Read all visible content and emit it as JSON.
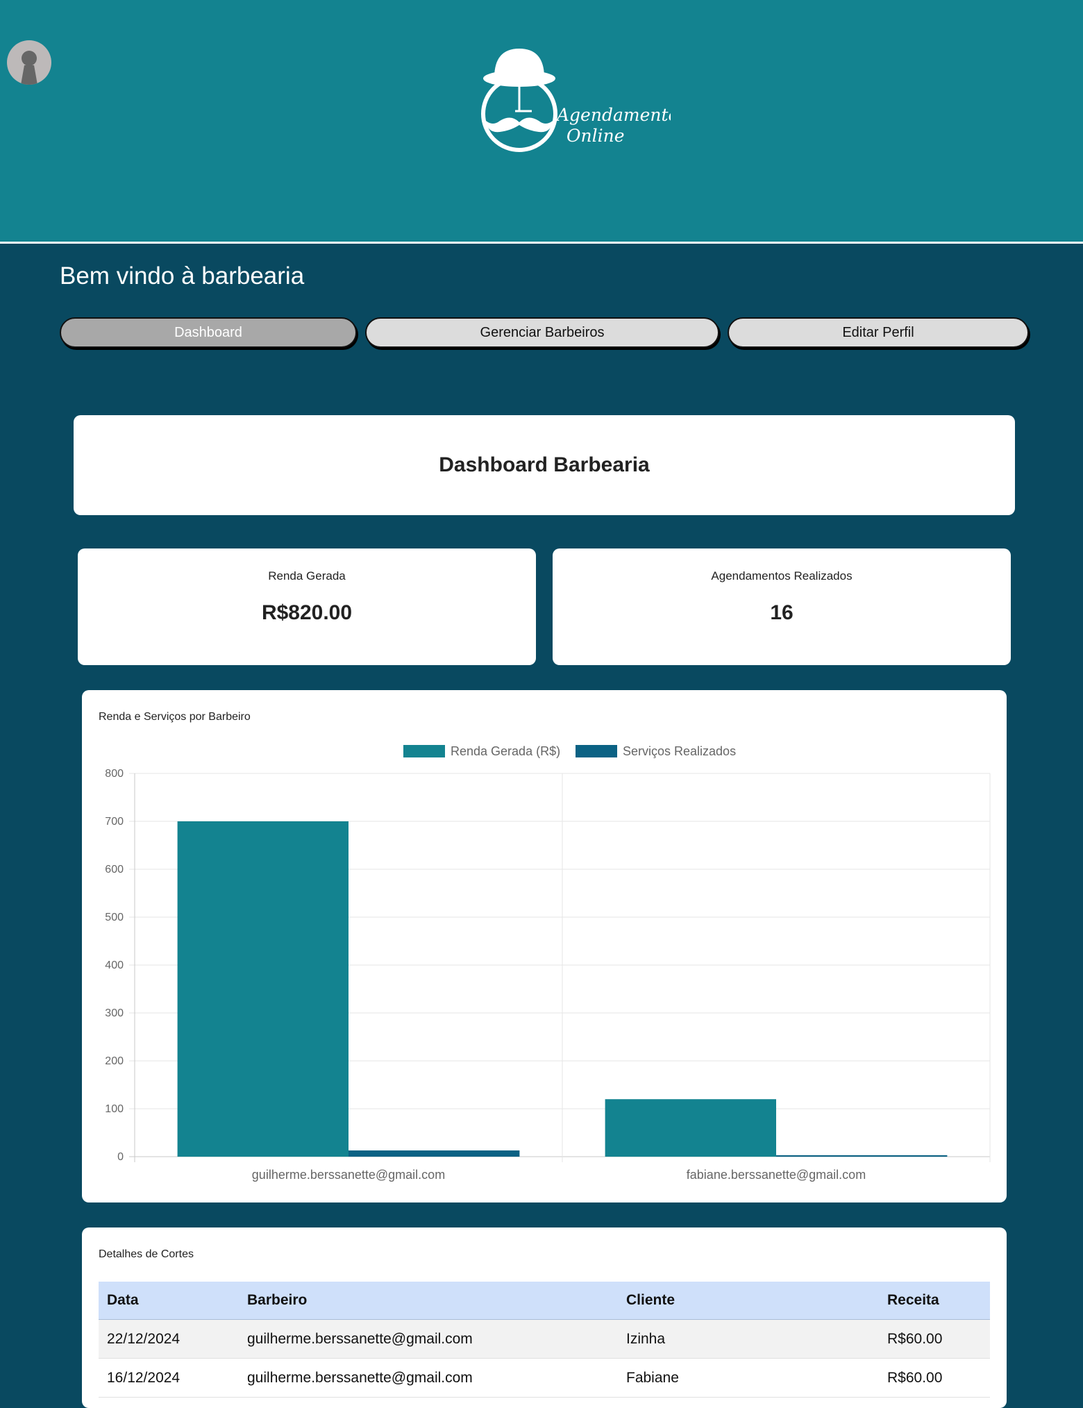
{
  "header": {
    "logo_line1": "Agendamento",
    "logo_line2": "Online"
  },
  "welcome": "Bem vindo à barbearia",
  "nav": {
    "dashboard": "Dashboard",
    "barbeiros": "Gerenciar Barbeiros",
    "perfil": "Editar Perfil",
    "active": "Dashboard"
  },
  "dashboard_title": "Dashboard Barbearia",
  "stats": {
    "renda_label": "Renda Gerada",
    "renda_value": "R$820.00",
    "agend_label": "Agendamentos Realizados",
    "agend_value": "16"
  },
  "chart_card_title": "Renda e Serviços por Barbeiro",
  "chart_data": {
    "type": "bar",
    "categories": [
      "guilherme.berssanette@gmail.com",
      "fabiane.berssanette@gmail.com"
    ],
    "series": [
      {
        "name": "Renda Gerada (R$)",
        "values": [
          700,
          120
        ],
        "color": "#138390"
      },
      {
        "name": "Serviços Realizados",
        "values": [
          13,
          3
        ],
        "color": "#0b6284"
      }
    ],
    "ylim": [
      0,
      800
    ],
    "yticks": [
      0,
      100,
      200,
      300,
      400,
      500,
      600,
      700,
      800
    ],
    "grid": true,
    "legend": "top-center"
  },
  "details": {
    "title": "Detalhes de Cortes",
    "columns": [
      "Data",
      "Barbeiro",
      "Cliente",
      "Receita"
    ],
    "rows": [
      [
        "22/12/2024",
        "guilherme.berssanette@gmail.com",
        "Izinha",
        "R$60.00"
      ],
      [
        "16/12/2024",
        "guilherme.berssanette@gmail.com",
        "Fabiane",
        "R$60.00"
      ]
    ]
  }
}
